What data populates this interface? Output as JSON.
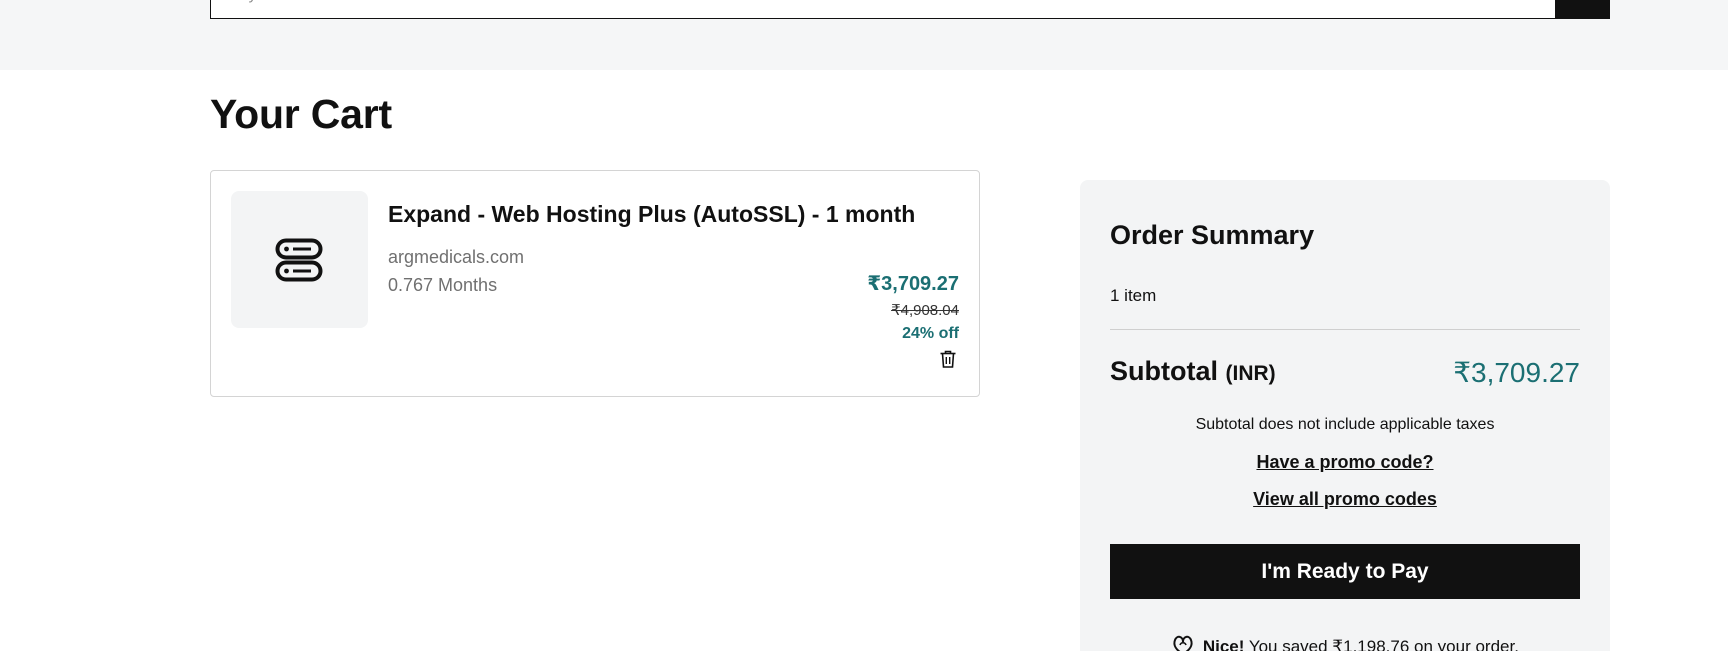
{
  "search": {
    "placeholder": "Buy a domain"
  },
  "page": {
    "title": "Your Cart"
  },
  "cart": {
    "items": [
      {
        "title": "Expand - Web Hosting Plus (AutoSSL) - 1 month",
        "domain": "argmedicals.com",
        "term": "0.767 Months",
        "price": "₹3,709.27",
        "original_price": "₹4,908.04",
        "discount": "24% off",
        "icon": "server-icon"
      }
    ]
  },
  "summary": {
    "title": "Order Summary",
    "item_count": "1 item",
    "subtotal_label": "Subtotal",
    "subtotal_currency": "(INR)",
    "subtotal_value": "₹3,709.27",
    "tax_note": "Subtotal does not include applicable taxes",
    "promo_have": "Have a promo code?",
    "promo_view_all": "View all promo codes",
    "pay_button": "I'm Ready to Pay",
    "savings_prefix": "Nice!",
    "savings_text": "You saved ₹1,198.76 on your order."
  },
  "colors": {
    "accent": "#1b6f73",
    "button": "#111111",
    "panel": "#f3f4f5"
  }
}
